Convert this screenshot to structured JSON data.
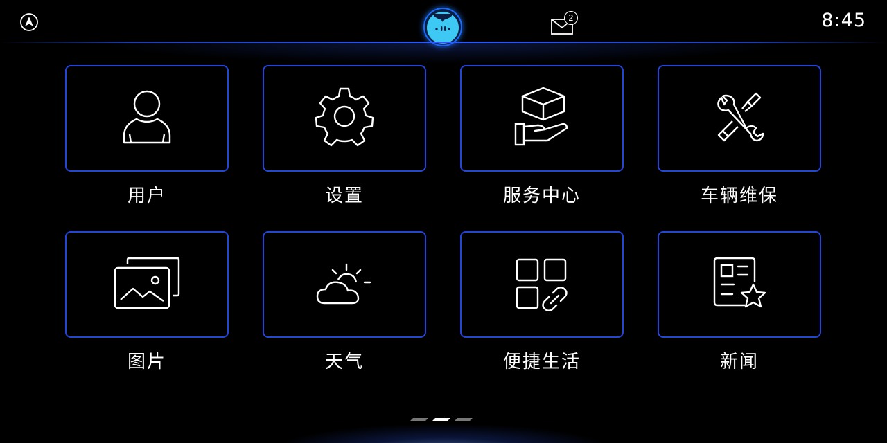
{
  "status_bar": {
    "time": "8:45",
    "mail_count": "2",
    "nav_icon": "navigation-arrow-icon",
    "avatar_icon": "assistant-avatar-icon",
    "mail_icon": "mail-icon"
  },
  "tiles": [
    {
      "label": "用户",
      "icon": "user-icon"
    },
    {
      "label": "设置",
      "icon": "gear-icon"
    },
    {
      "label": "服务中心",
      "icon": "service-hand-box-icon"
    },
    {
      "label": "车辆维保",
      "icon": "wrench-screwdriver-icon"
    },
    {
      "label": "图片",
      "icon": "gallery-icon"
    },
    {
      "label": "天气",
      "icon": "sun-cloud-icon"
    },
    {
      "label": "便捷生活",
      "icon": "apps-link-icon"
    },
    {
      "label": "新闻",
      "icon": "news-star-icon"
    }
  ],
  "pagination": {
    "pages": 3,
    "active": 2
  },
  "colors": {
    "accent": "#2346d6",
    "avatar_face": "#3ec8f4",
    "background": "#000000"
  }
}
